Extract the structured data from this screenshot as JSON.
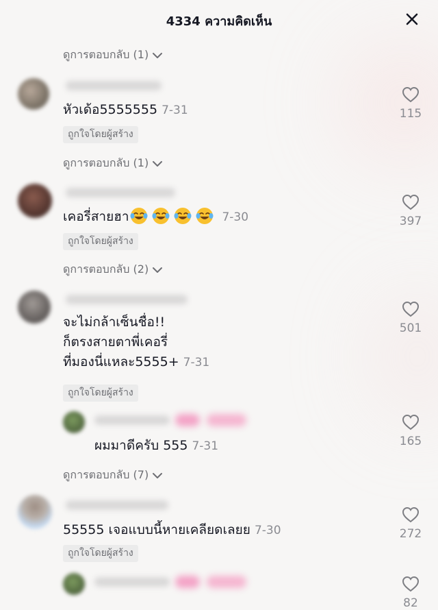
{
  "header": {
    "title": "4334 ความคิดเห็น",
    "close_icon": "close-icon"
  },
  "view_replies": [
    {
      "label": "ดูการตอบกลับ (1)"
    },
    {
      "label": "ดูการตอบกลับ (1)"
    },
    {
      "label": "ดูการตอบกลับ (2)"
    },
    {
      "label": "ดูการตอบกลับ (7)"
    }
  ],
  "comments": [
    {
      "text": "หัวเด้อ5555555",
      "date": "7-31",
      "creator_liked": "ถูกใจโดยผู้สร้าง",
      "likes": "115"
    },
    {
      "text": "เคอรี่สายฮา",
      "emoji": "face-with-tears-of-joy-emoji",
      "date": "7-30",
      "creator_liked": "ถูกใจโดยผู้สร้าง",
      "likes": "397"
    },
    {
      "lines": [
        "จะไม่กล้าเซ็นชื่อ!!",
        "ก็ตรงสายตาพี่เคอรี่",
        "ที่มองนี่แหละ5555+"
      ],
      "date": "7-31",
      "creator_liked": "ถูกใจโดยผู้สร้าง",
      "likes": "501"
    },
    {
      "text": "ผมมาดีครับ 555",
      "date": "7-31",
      "likes": "165"
    },
    {
      "text": "55555 เจอแบบนี้หายเคลียดเลยย",
      "date": "7-30",
      "creator_liked": "ถูกใจโดยผู้สร้าง",
      "likes": "272"
    },
    {
      "likes": "82"
    }
  ],
  "icons": {
    "like": "heart-outline-icon",
    "expand": "chevron-down-icon"
  },
  "colors": {
    "text": "#161823",
    "secondary": "#8a8b91",
    "badge_bg": "#ebebeb",
    "blurred_badge": "#f5a3c8"
  }
}
